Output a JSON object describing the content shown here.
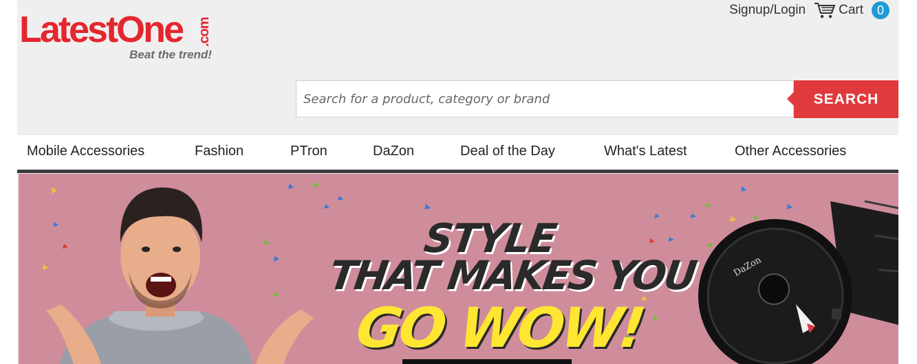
{
  "header": {
    "logo_text": "LatestOne",
    "logo_suffix": ".com",
    "logo_tagline": "Beat the trend!",
    "signup_login": "Signup/Login",
    "cart_label": "Cart",
    "cart_count": "0"
  },
  "search": {
    "placeholder": "Search for a product, category or brand",
    "value": "",
    "button_label": "SEARCH"
  },
  "nav": {
    "items": [
      {
        "label": "Mobile Accessories"
      },
      {
        "label": "Fashion"
      },
      {
        "label": "PTron"
      },
      {
        "label": "DaZon"
      },
      {
        "label": "Deal of the Day"
      },
      {
        "label": "What's Latest"
      },
      {
        "label": "Other Accessories"
      }
    ]
  },
  "banner": {
    "line1": "STYLE",
    "line2": "THAT MAKES YOU",
    "line3": "GO WOW!",
    "watch_brand": "DaZon"
  },
  "colors": {
    "brand_red": "#e5262f",
    "search_button": "#e03a3c",
    "cart_badge": "#1e9ad6",
    "banner_bg": "#cf8d9b",
    "headline_yellow": "#ffe633"
  }
}
